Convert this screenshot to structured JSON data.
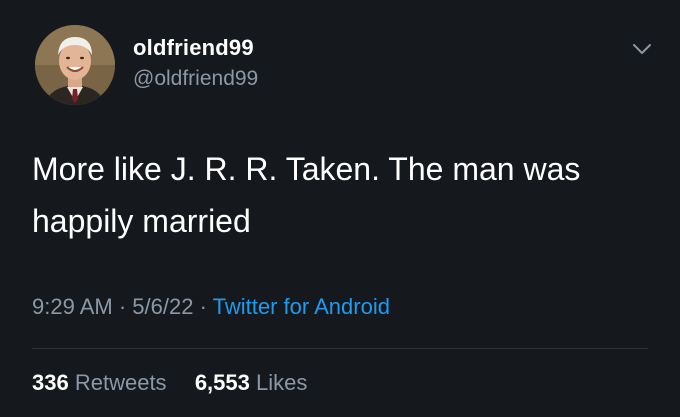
{
  "tweet": {
    "display_name": "oldfriend99",
    "handle": "@oldfriend99",
    "text_line1": "More like J. R. R. Taken. The man was",
    "text_line2": "happily married",
    "time": "9:29 AM",
    "date": "5/6/22",
    "source": "Twitter for Android",
    "separator": "·",
    "retweets_count": "336",
    "retweets_label": "Retweets",
    "likes_count": "6,553",
    "likes_label": "Likes"
  },
  "colors": {
    "background": "#15181c",
    "text_primary": "#ffffff",
    "text_secondary": "#8b98a5",
    "link": "#1d9bf0",
    "divider": "#2f3336"
  },
  "icons": {
    "more": "chevron-down-icon",
    "avatar": "profile-photo"
  }
}
